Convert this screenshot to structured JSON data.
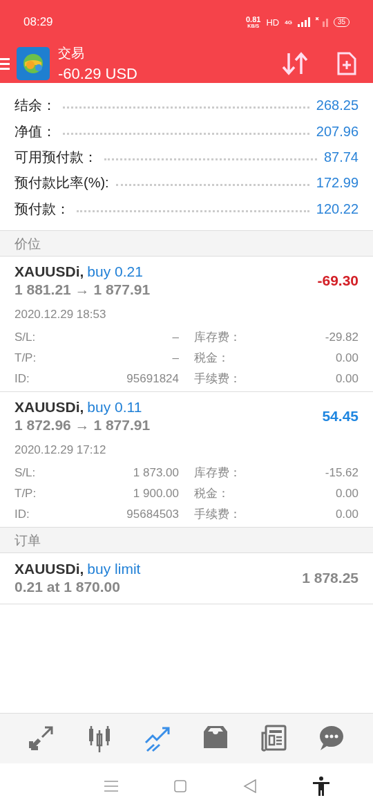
{
  "status_bar": {
    "time": "08:29",
    "speed": "0.81",
    "speed_unit": "KB/S",
    "hd": "HD",
    "network": "4G",
    "battery": "35"
  },
  "header": {
    "title": "交易",
    "subtitle": "-60.29 USD"
  },
  "summary": [
    {
      "label": "结余：",
      "value": "268.25"
    },
    {
      "label": "净值：",
      "value": "207.96"
    },
    {
      "label": "可用预付款：",
      "value": "87.74"
    },
    {
      "label": "预付款比率(%):",
      "value": "172.99"
    },
    {
      "label": "预付款：",
      "value": "120.22"
    }
  ],
  "positions_header": "价位",
  "positions": [
    {
      "symbol": "XAUUSDi,",
      "side": "buy 0.21",
      "prices": "1 881.21 → 1 877.91",
      "profit": "-69.30",
      "kind": "loss",
      "time": "2020.12.29 18:53",
      "details": [
        {
          "label": "S/L:",
          "value": "–"
        },
        {
          "label": "库存费：",
          "value": "-29.82"
        },
        {
          "label": "T/P:",
          "value": "–"
        },
        {
          "label": "税金：",
          "value": "0.00"
        },
        {
          "label": "ID:",
          "value": "95691824"
        },
        {
          "label": "手续费：",
          "value": "0.00"
        }
      ]
    },
    {
      "symbol": "XAUUSDi,",
      "side": "buy 0.11",
      "prices": "1 872.96 → 1 877.91",
      "profit": "54.45",
      "kind": "gain",
      "time": "2020.12.29 17:12",
      "details": [
        {
          "label": "S/L:",
          "value": "1 873.00"
        },
        {
          "label": "库存费：",
          "value": "-15.62"
        },
        {
          "label": "T/P:",
          "value": "1 900.00"
        },
        {
          "label": "税金：",
          "value": "0.00"
        },
        {
          "label": "ID:",
          "value": "95684503"
        },
        {
          "label": "手续费：",
          "value": "0.00"
        }
      ]
    }
  ],
  "orders_header": "订单",
  "orders": [
    {
      "symbol": "XAUUSDi,",
      "side": "buy limit",
      "detail": "0.21 at 1 870.00",
      "price": "1 878.25"
    }
  ],
  "bottom_nav": [
    {
      "kind": "trade",
      "selected": false
    },
    {
      "kind": "chart",
      "selected": false
    },
    {
      "kind": "trend",
      "selected": true
    },
    {
      "kind": "inbox",
      "selected": false
    },
    {
      "kind": "news",
      "selected": false
    },
    {
      "kind": "chat",
      "selected": false
    }
  ]
}
